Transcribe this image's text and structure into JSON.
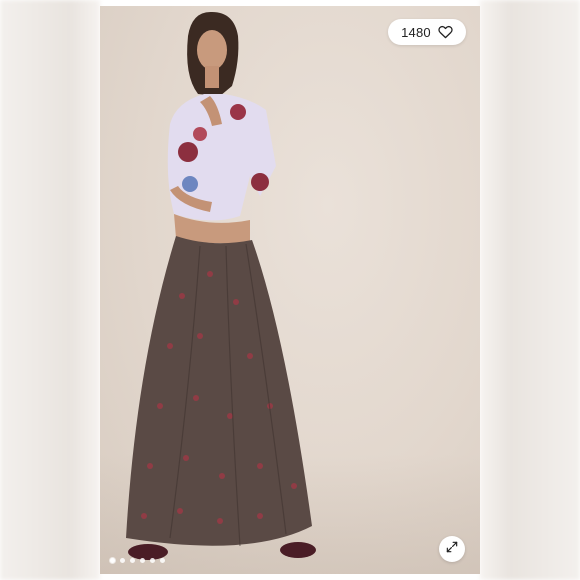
{
  "listing": {
    "like_count": "1480"
  },
  "icons": {
    "like": "heart-outline-icon",
    "expand": "expand-arrows-icon"
  },
  "carousel": {
    "total_images": 6,
    "active_index": 0
  },
  "colors": {
    "background": "#ffffff",
    "pill": "#ffffff",
    "text": "#222222"
  }
}
